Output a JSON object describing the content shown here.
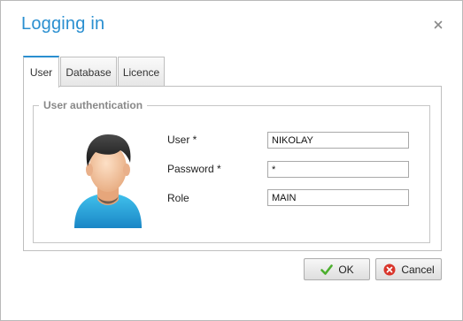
{
  "dialog": {
    "title": "Logging in",
    "close_icon": "close-icon"
  },
  "tabs": [
    {
      "label": "User",
      "active": true
    },
    {
      "label": "Database",
      "active": false
    },
    {
      "label": "Licence",
      "active": false
    }
  ],
  "auth": {
    "legend": "User authentication",
    "avatar_icon": "user-avatar-icon",
    "fields": [
      {
        "label": "User *",
        "value": "NIKOLAY"
      },
      {
        "label": "Password *",
        "value": "*"
      },
      {
        "label": "Role",
        "value": "MAIN"
      }
    ]
  },
  "buttons": {
    "ok_label": "OK",
    "ok_icon": "checkmark-icon",
    "cancel_label": "Cancel",
    "cancel_icon": "cancel-icon"
  },
  "colors": {
    "accent": "#2a8fd0",
    "ok_green": "#4caf2e",
    "cancel_red": "#d9352b"
  }
}
